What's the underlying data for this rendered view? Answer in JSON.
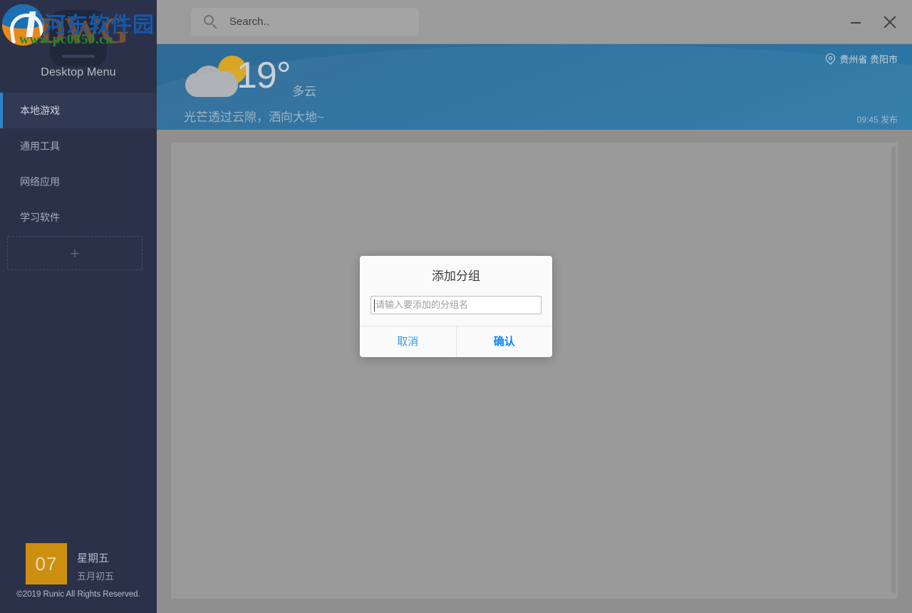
{
  "app": {
    "brand_title": "Desktop Menu",
    "copyright": "©2019 Runic All Rights Reserved."
  },
  "watermark": {
    "site_name_cn": "河东软件园",
    "site_url": "www.pc0359.cn",
    "ghost_text": "DWG"
  },
  "header": {
    "search": {
      "placeholder": "Search..",
      "icon": "search-icon"
    },
    "window_controls": {
      "minimize_label": "–",
      "close_label": "✕"
    }
  },
  "sidebar": {
    "items": [
      {
        "label": "本地游戏",
        "active": true
      },
      {
        "label": "通用工具",
        "active": false
      },
      {
        "label": "网络应用",
        "active": false
      },
      {
        "label": "学习软件",
        "active": false
      }
    ],
    "add_group_label": "+",
    "date": {
      "day": "07",
      "weekday": "星期五",
      "lunar": "五月初五"
    }
  },
  "weather": {
    "temperature": "19°",
    "condition": "多云",
    "phrase": "光芒透过云隙，洒向大地~",
    "location": "贵州省 贵阳市",
    "publish_time": "09:45 发布",
    "icon": "cloud-sun-icon",
    "location_icon": "map-pin-icon"
  },
  "modal": {
    "title": "添加分组",
    "input_placeholder": "请输入要添加的分组名",
    "input_value": "",
    "cancel_label": "取消",
    "confirm_label": "确认"
  },
  "colors": {
    "sidebar_bg": "#2b3149",
    "accent_blue": "#2d84c8",
    "weather_bg": "#2a6f9e",
    "date_badge": "#cc8f10",
    "link_blue": "#0a84ff"
  }
}
